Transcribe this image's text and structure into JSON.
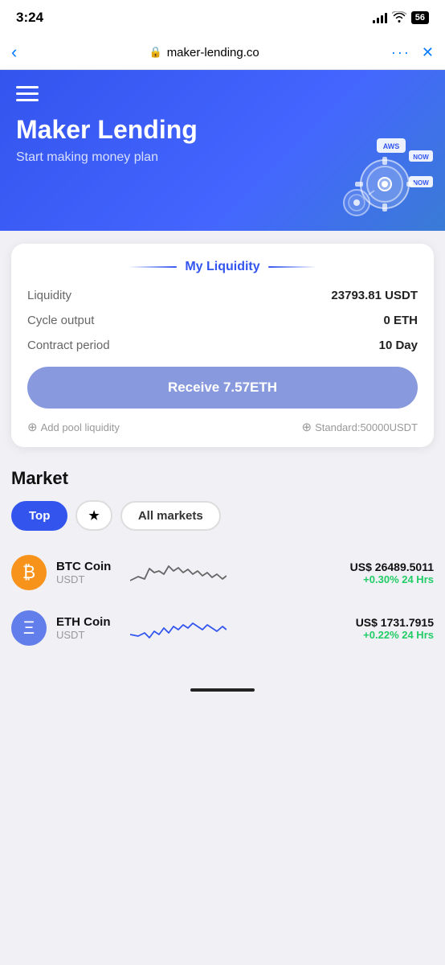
{
  "statusBar": {
    "time": "3:24",
    "battery": "56"
  },
  "browserBar": {
    "url": "maker-lending.co",
    "backLabel": "‹",
    "moreLabel": "···",
    "closeLabel": "✕"
  },
  "hero": {
    "menuLabel": "menu",
    "title": "Maker Lending",
    "subtitle": "Start making money plan"
  },
  "liquidity": {
    "sectionTitle": "My Liquidity",
    "liquidityLabel": "Liquidity",
    "liquidityValue": "23793.81 USDT",
    "cycleOutputLabel": "Cycle output",
    "cycleOutputValue": "0 ETH",
    "contractPeriodLabel": "Contract period",
    "contractPeriodValue": "10 Day",
    "receiveButton": "Receive 7.57ETH",
    "addPoolLabel": "Add pool liquidity",
    "standardLabel": "Standard:50000USDT"
  },
  "market": {
    "sectionTitle": "Market",
    "filters": [
      {
        "label": "Top",
        "type": "active"
      },
      {
        "label": "★",
        "type": "star"
      },
      {
        "label": "All markets",
        "type": "outline"
      }
    ],
    "coins": [
      {
        "name": "BTC Coin",
        "pair": "USDT",
        "iconType": "btc",
        "iconSymbol": "₿",
        "price": "US$ 26489.5011",
        "change": "+0.30% 24 Hrs",
        "changeType": "positive"
      },
      {
        "name": "ETH Coin",
        "pair": "USDT",
        "iconType": "eth",
        "iconSymbol": "Ξ",
        "price": "US$ 1731.7915",
        "change": "+0.22% 24 Hrs",
        "changeType": "positive"
      }
    ]
  }
}
